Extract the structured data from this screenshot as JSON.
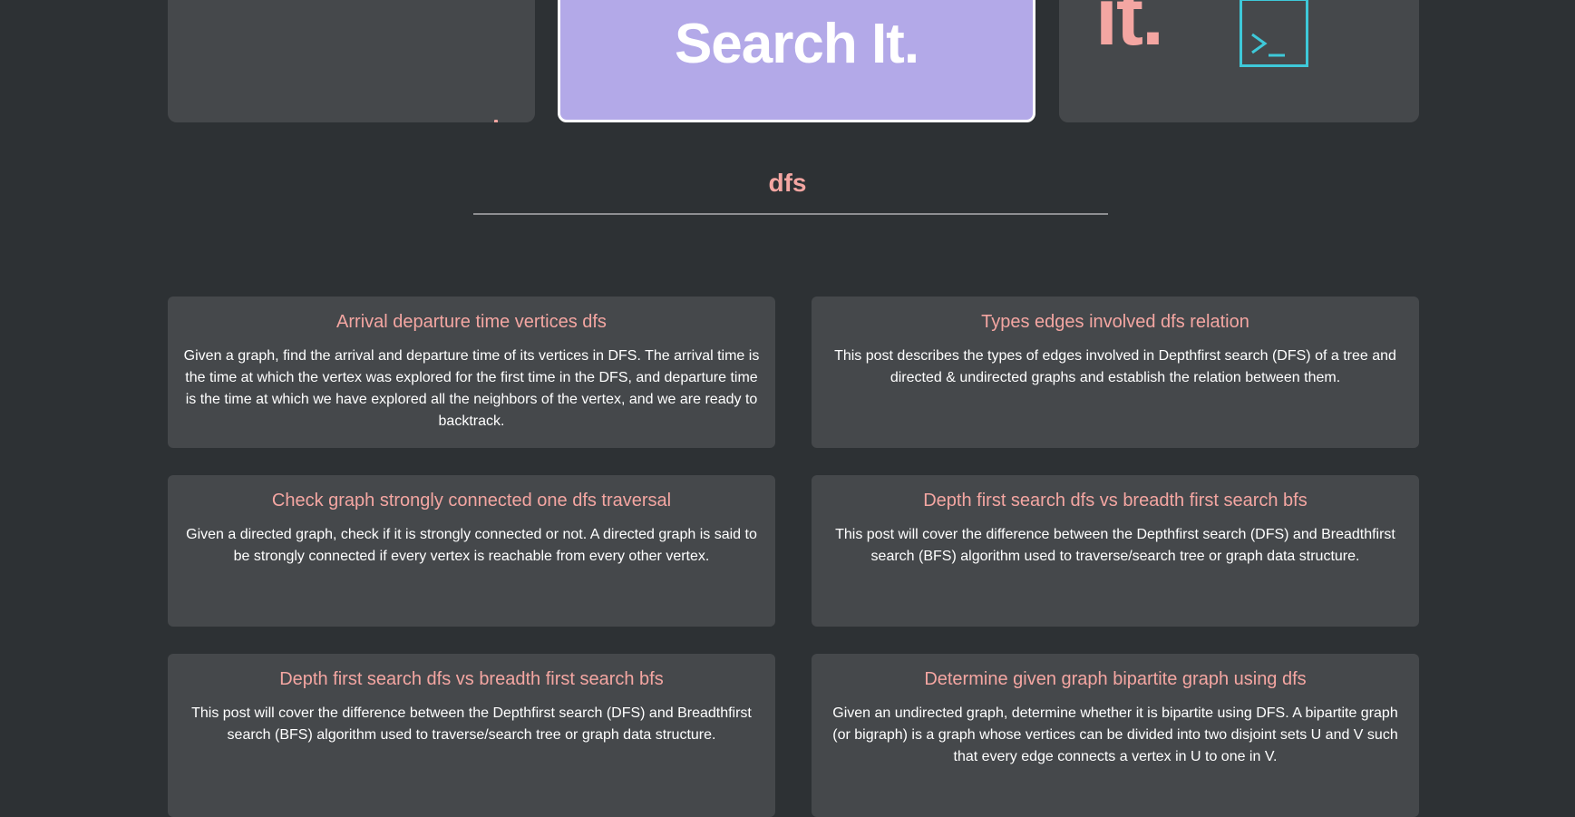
{
  "hero": {
    "search_label": "Search It.",
    "right_text": "it."
  },
  "section": {
    "title": "dfs"
  },
  "posts": [
    {
      "title": "Arrival departure time vertices dfs",
      "description": "Given a graph, find the arrival and departure time of its vertices in DFS. The arrival time is the time at which the vertex was explored for the first time in the DFS, and departure time is the time at which we have explored all the neighbors of the vertex, and we are ready to backtrack."
    },
    {
      "title": "Types edges involved dfs relation",
      "description": "This post describes the types of edges involved in Depthfirst search (DFS) of a tree and directed & undirected graphs and establish the relation between them."
    },
    {
      "title": "Check graph strongly connected one dfs traversal",
      "description": "Given a directed graph, check if it is strongly connected or not. A directed graph is said to be strongly connected if every vertex is reachable from every other vertex."
    },
    {
      "title": "Depth first search dfs vs breadth first search bfs",
      "description": "This post will cover the difference between the Depthfirst search (DFS) and Breadthfirst search (BFS) algorithm used to traverse/search tree or graph data structure."
    },
    {
      "title": "Depth first search dfs vs breadth first search bfs",
      "description": "This post will cover the difference between the Depthfirst search (DFS) and Breadthfirst search (BFS) algorithm used to traverse/search tree or graph data structure."
    },
    {
      "title": "Determine given graph bipartite graph using dfs",
      "description": "Given an undirected graph, determine whether it is bipartite using DFS. A bipartite graph (or bigraph) is a graph whose vertices can be divided into two disjoint sets U and V such that every edge connects a vertex in U to one in V."
    }
  ],
  "icons": {
    "terminal": "terminal-icon"
  },
  "colors": {
    "background": "#2d3134",
    "card": "#45484b",
    "accent_pink": "#f4a6a2",
    "accent_purple": "#b3a9e8",
    "terminal_cyan": "#3ec9d9"
  }
}
